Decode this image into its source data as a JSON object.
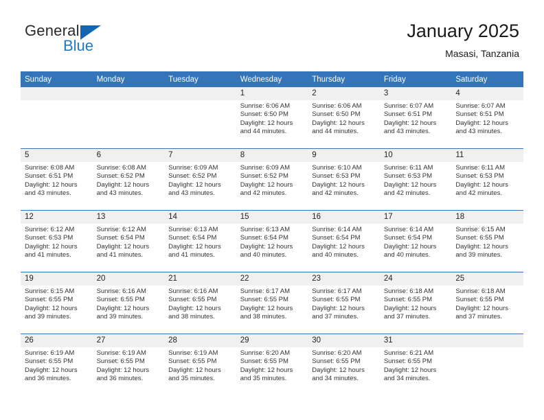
{
  "brand": {
    "name_part1": "General",
    "name_part2": "Blue",
    "accent_color": "#1f78c1",
    "triangle_color": "#1565b0"
  },
  "header": {
    "title": "January 2025",
    "subtitle": "Masasi, Tanzania"
  },
  "calendar": {
    "header_bg": "#3375b8",
    "daynum_bg": "#f0f0f0",
    "weekday_headers": [
      "Sunday",
      "Monday",
      "Tuesday",
      "Wednesday",
      "Thursday",
      "Friday",
      "Saturday"
    ],
    "weeks": [
      [
        {
          "day": "",
          "sunrise": "",
          "sunset": "",
          "daylight_line1": "",
          "daylight_line2": "",
          "empty": true
        },
        {
          "day": "",
          "sunrise": "",
          "sunset": "",
          "daylight_line1": "",
          "daylight_line2": "",
          "empty": true
        },
        {
          "day": "",
          "sunrise": "",
          "sunset": "",
          "daylight_line1": "",
          "daylight_line2": "",
          "empty": true
        },
        {
          "day": "1",
          "sunrise": "Sunrise: 6:06 AM",
          "sunset": "Sunset: 6:50 PM",
          "daylight_line1": "Daylight: 12 hours",
          "daylight_line2": "and 44 minutes.",
          "empty": false
        },
        {
          "day": "2",
          "sunrise": "Sunrise: 6:06 AM",
          "sunset": "Sunset: 6:50 PM",
          "daylight_line1": "Daylight: 12 hours",
          "daylight_line2": "and 44 minutes.",
          "empty": false
        },
        {
          "day": "3",
          "sunrise": "Sunrise: 6:07 AM",
          "sunset": "Sunset: 6:51 PM",
          "daylight_line1": "Daylight: 12 hours",
          "daylight_line2": "and 43 minutes.",
          "empty": false
        },
        {
          "day": "4",
          "sunrise": "Sunrise: 6:07 AM",
          "sunset": "Sunset: 6:51 PM",
          "daylight_line1": "Daylight: 12 hours",
          "daylight_line2": "and 43 minutes.",
          "empty": false
        }
      ],
      [
        {
          "day": "5",
          "sunrise": "Sunrise: 6:08 AM",
          "sunset": "Sunset: 6:51 PM",
          "daylight_line1": "Daylight: 12 hours",
          "daylight_line2": "and 43 minutes.",
          "empty": false
        },
        {
          "day": "6",
          "sunrise": "Sunrise: 6:08 AM",
          "sunset": "Sunset: 6:52 PM",
          "daylight_line1": "Daylight: 12 hours",
          "daylight_line2": "and 43 minutes.",
          "empty": false
        },
        {
          "day": "7",
          "sunrise": "Sunrise: 6:09 AM",
          "sunset": "Sunset: 6:52 PM",
          "daylight_line1": "Daylight: 12 hours",
          "daylight_line2": "and 43 minutes.",
          "empty": false
        },
        {
          "day": "8",
          "sunrise": "Sunrise: 6:09 AM",
          "sunset": "Sunset: 6:52 PM",
          "daylight_line1": "Daylight: 12 hours",
          "daylight_line2": "and 42 minutes.",
          "empty": false
        },
        {
          "day": "9",
          "sunrise": "Sunrise: 6:10 AM",
          "sunset": "Sunset: 6:53 PM",
          "daylight_line1": "Daylight: 12 hours",
          "daylight_line2": "and 42 minutes.",
          "empty": false
        },
        {
          "day": "10",
          "sunrise": "Sunrise: 6:11 AM",
          "sunset": "Sunset: 6:53 PM",
          "daylight_line1": "Daylight: 12 hours",
          "daylight_line2": "and 42 minutes.",
          "empty": false
        },
        {
          "day": "11",
          "sunrise": "Sunrise: 6:11 AM",
          "sunset": "Sunset: 6:53 PM",
          "daylight_line1": "Daylight: 12 hours",
          "daylight_line2": "and 42 minutes.",
          "empty": false
        }
      ],
      [
        {
          "day": "12",
          "sunrise": "Sunrise: 6:12 AM",
          "sunset": "Sunset: 6:53 PM",
          "daylight_line1": "Daylight: 12 hours",
          "daylight_line2": "and 41 minutes.",
          "empty": false
        },
        {
          "day": "13",
          "sunrise": "Sunrise: 6:12 AM",
          "sunset": "Sunset: 6:54 PM",
          "daylight_line1": "Daylight: 12 hours",
          "daylight_line2": "and 41 minutes.",
          "empty": false
        },
        {
          "day": "14",
          "sunrise": "Sunrise: 6:13 AM",
          "sunset": "Sunset: 6:54 PM",
          "daylight_line1": "Daylight: 12 hours",
          "daylight_line2": "and 41 minutes.",
          "empty": false
        },
        {
          "day": "15",
          "sunrise": "Sunrise: 6:13 AM",
          "sunset": "Sunset: 6:54 PM",
          "daylight_line1": "Daylight: 12 hours",
          "daylight_line2": "and 40 minutes.",
          "empty": false
        },
        {
          "day": "16",
          "sunrise": "Sunrise: 6:14 AM",
          "sunset": "Sunset: 6:54 PM",
          "daylight_line1": "Daylight: 12 hours",
          "daylight_line2": "and 40 minutes.",
          "empty": false
        },
        {
          "day": "17",
          "sunrise": "Sunrise: 6:14 AM",
          "sunset": "Sunset: 6:54 PM",
          "daylight_line1": "Daylight: 12 hours",
          "daylight_line2": "and 40 minutes.",
          "empty": false
        },
        {
          "day": "18",
          "sunrise": "Sunrise: 6:15 AM",
          "sunset": "Sunset: 6:55 PM",
          "daylight_line1": "Daylight: 12 hours",
          "daylight_line2": "and 39 minutes.",
          "empty": false
        }
      ],
      [
        {
          "day": "19",
          "sunrise": "Sunrise: 6:15 AM",
          "sunset": "Sunset: 6:55 PM",
          "daylight_line1": "Daylight: 12 hours",
          "daylight_line2": "and 39 minutes.",
          "empty": false
        },
        {
          "day": "20",
          "sunrise": "Sunrise: 6:16 AM",
          "sunset": "Sunset: 6:55 PM",
          "daylight_line1": "Daylight: 12 hours",
          "daylight_line2": "and 39 minutes.",
          "empty": false
        },
        {
          "day": "21",
          "sunrise": "Sunrise: 6:16 AM",
          "sunset": "Sunset: 6:55 PM",
          "daylight_line1": "Daylight: 12 hours",
          "daylight_line2": "and 38 minutes.",
          "empty": false
        },
        {
          "day": "22",
          "sunrise": "Sunrise: 6:17 AM",
          "sunset": "Sunset: 6:55 PM",
          "daylight_line1": "Daylight: 12 hours",
          "daylight_line2": "and 38 minutes.",
          "empty": false
        },
        {
          "day": "23",
          "sunrise": "Sunrise: 6:17 AM",
          "sunset": "Sunset: 6:55 PM",
          "daylight_line1": "Daylight: 12 hours",
          "daylight_line2": "and 37 minutes.",
          "empty": false
        },
        {
          "day": "24",
          "sunrise": "Sunrise: 6:18 AM",
          "sunset": "Sunset: 6:55 PM",
          "daylight_line1": "Daylight: 12 hours",
          "daylight_line2": "and 37 minutes.",
          "empty": false
        },
        {
          "day": "25",
          "sunrise": "Sunrise: 6:18 AM",
          "sunset": "Sunset: 6:55 PM",
          "daylight_line1": "Daylight: 12 hours",
          "daylight_line2": "and 37 minutes.",
          "empty": false
        }
      ],
      [
        {
          "day": "26",
          "sunrise": "Sunrise: 6:19 AM",
          "sunset": "Sunset: 6:55 PM",
          "daylight_line1": "Daylight: 12 hours",
          "daylight_line2": "and 36 minutes.",
          "empty": false
        },
        {
          "day": "27",
          "sunrise": "Sunrise: 6:19 AM",
          "sunset": "Sunset: 6:55 PM",
          "daylight_line1": "Daylight: 12 hours",
          "daylight_line2": "and 36 minutes.",
          "empty": false
        },
        {
          "day": "28",
          "sunrise": "Sunrise: 6:19 AM",
          "sunset": "Sunset: 6:55 PM",
          "daylight_line1": "Daylight: 12 hours",
          "daylight_line2": "and 35 minutes.",
          "empty": false
        },
        {
          "day": "29",
          "sunrise": "Sunrise: 6:20 AM",
          "sunset": "Sunset: 6:55 PM",
          "daylight_line1": "Daylight: 12 hours",
          "daylight_line2": "and 35 minutes.",
          "empty": false
        },
        {
          "day": "30",
          "sunrise": "Sunrise: 6:20 AM",
          "sunset": "Sunset: 6:55 PM",
          "daylight_line1": "Daylight: 12 hours",
          "daylight_line2": "and 34 minutes.",
          "empty": false
        },
        {
          "day": "31",
          "sunrise": "Sunrise: 6:21 AM",
          "sunset": "Sunset: 6:55 PM",
          "daylight_line1": "Daylight: 12 hours",
          "daylight_line2": "and 34 minutes.",
          "empty": false
        },
        {
          "day": "",
          "sunrise": "",
          "sunset": "",
          "daylight_line1": "",
          "daylight_line2": "",
          "empty": true
        }
      ]
    ]
  }
}
